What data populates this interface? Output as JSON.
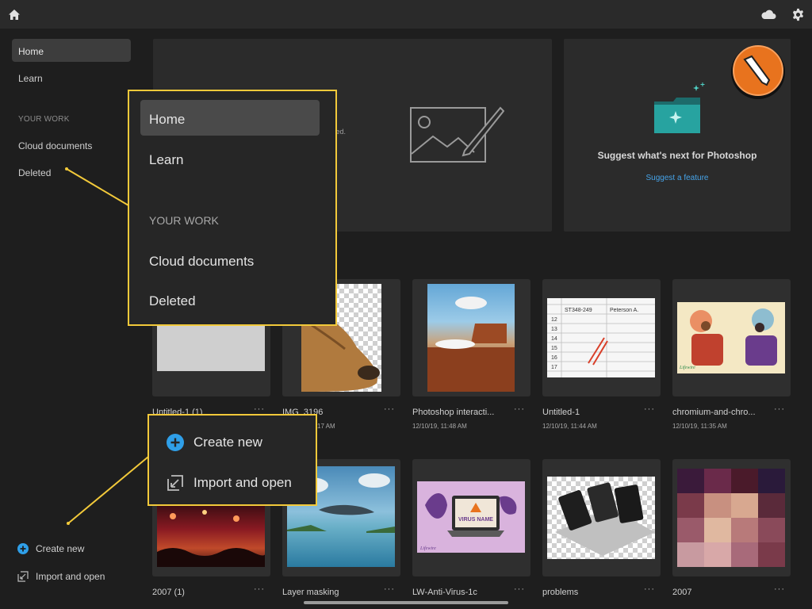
{
  "topbar": {
    "home_icon": "home-icon",
    "cloud_icon": "cloud-icon",
    "settings_icon": "gear-icon"
  },
  "sidebar": {
    "items": [
      {
        "label": "Home"
      },
      {
        "label": "Learn"
      }
    ],
    "section_heading": "YOUR WORK",
    "work_items": [
      {
        "label": "Cloud documents"
      },
      {
        "label": "Deleted"
      }
    ],
    "create_new": "Create new",
    "import_open": "Import and open"
  },
  "hero": {
    "partial_text": "ted.",
    "suggest_title": "Suggest what's next for Photoshop",
    "suggest_link": "Suggest a feature"
  },
  "colors": {
    "accent": "#f2c93a",
    "link": "#46a3e8",
    "plus": "#2f9fe8",
    "badge_orange": "#e8731e"
  },
  "files_row1": [
    {
      "name": "Untitled-1 (1)",
      "date": "",
      "more": "···"
    },
    {
      "name": "IMG_3196",
      "date": "17 AM",
      "more": "···"
    },
    {
      "name": "Photoshop interacti...",
      "date": "12/10/19, 11:48 AM",
      "more": "···"
    },
    {
      "name": "Untitled-1",
      "date": "12/10/19, 11:44 AM",
      "more": "···"
    },
    {
      "name": "chromium-and-chro...",
      "date": "12/10/19, 11:35 AM",
      "more": "···"
    }
  ],
  "files_row2": [
    {
      "name": "2007 (1)",
      "more": "···"
    },
    {
      "name": "Layer masking",
      "more": "···"
    },
    {
      "name": "LW-Anti-Virus-1c",
      "more": "···"
    },
    {
      "name": "problems",
      "more": "···"
    },
    {
      "name": "2007",
      "more": "···"
    }
  ],
  "thumb_text": {
    "table_head_a": "ST348-249",
    "table_head_b": "Peterson A.",
    "table_rows": [
      "12",
      "13",
      "14",
      "15",
      "16",
      "17"
    ],
    "virus_label": "VIRUS NAME",
    "lifewire": "Lifewire"
  },
  "callout_nav": {
    "items": [
      {
        "label": "Home"
      },
      {
        "label": "Learn"
      }
    ],
    "section_heading": "YOUR WORK",
    "work_items": [
      {
        "label": "Cloud documents"
      },
      {
        "label": "Deleted"
      }
    ]
  },
  "callout_actions": {
    "create_new": "Create new",
    "import_open": "Import and open"
  }
}
